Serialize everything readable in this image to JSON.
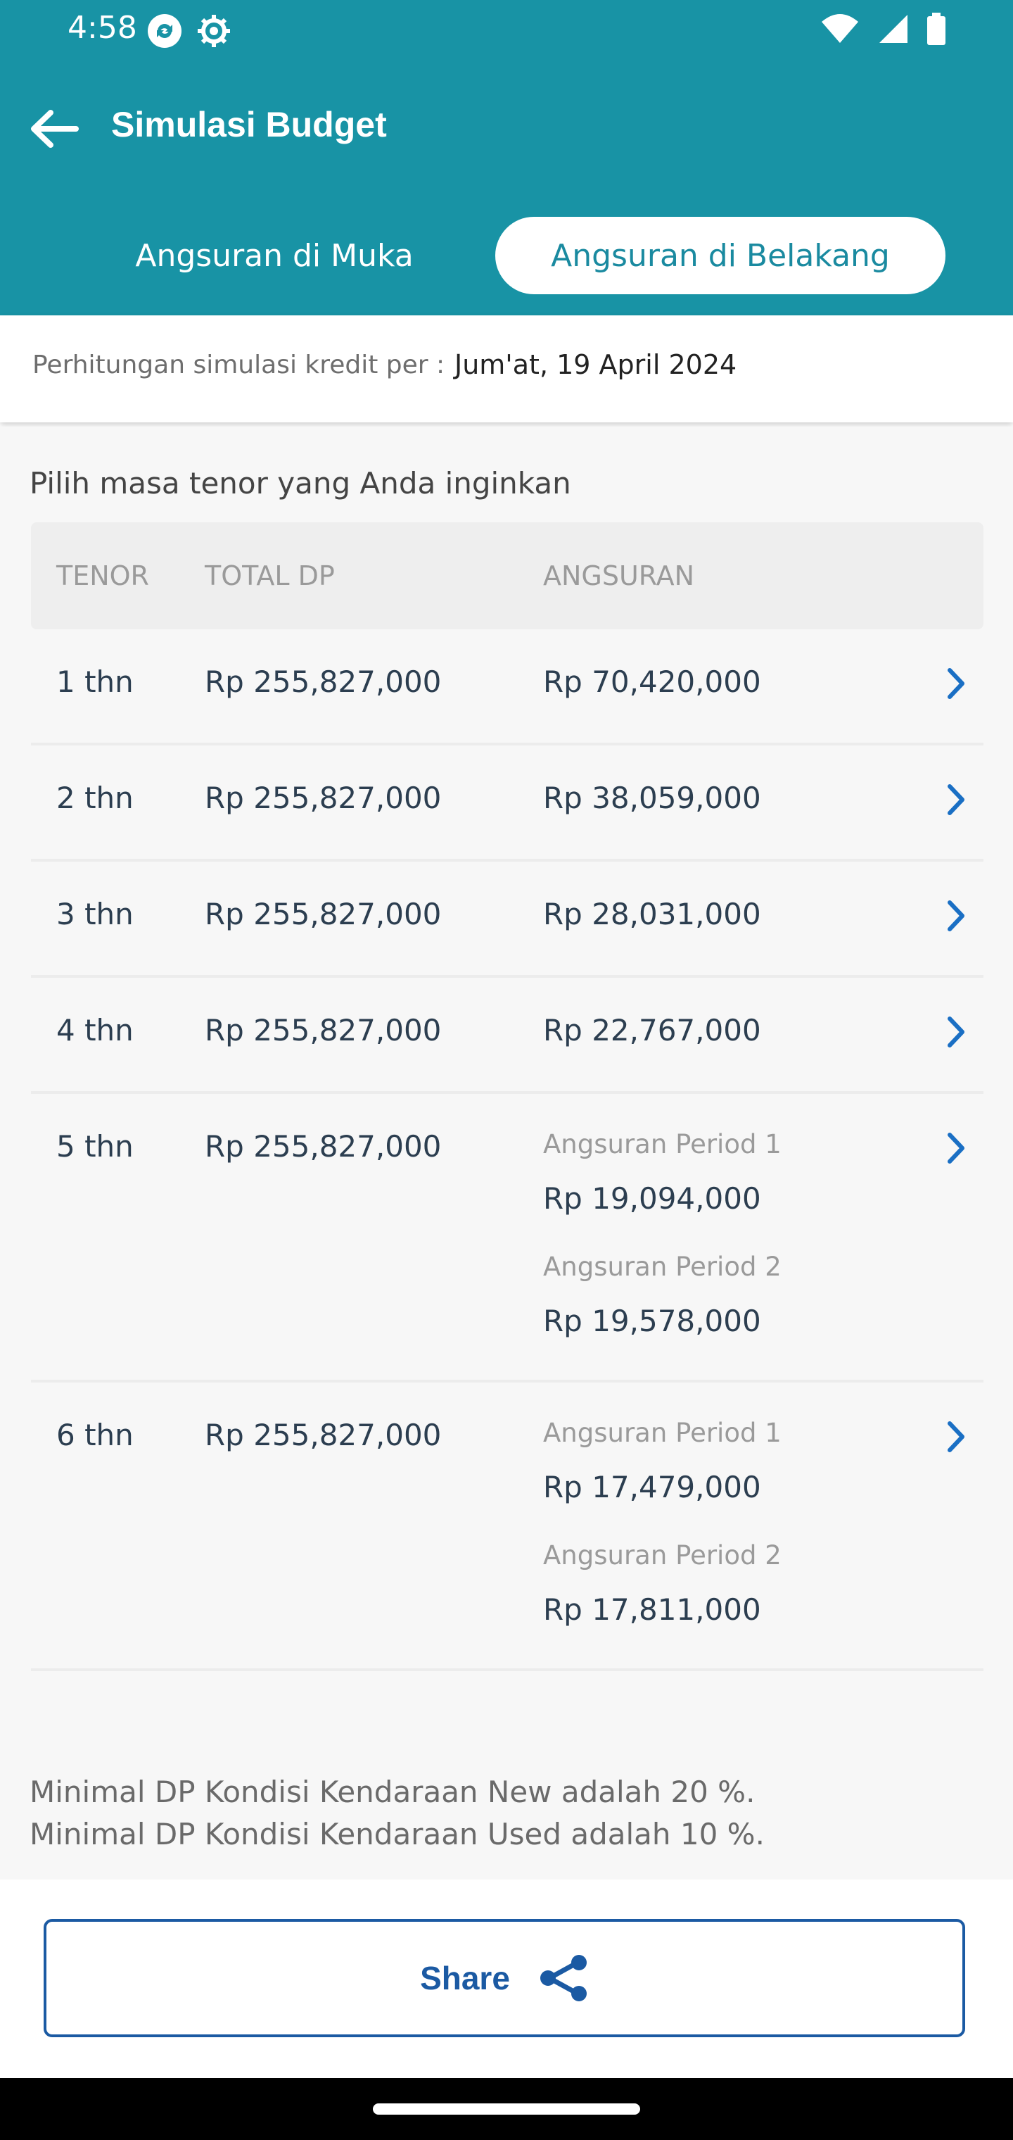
{
  "status_bar": {
    "time": "4:58"
  },
  "header": {
    "title": "Simulasi Budget"
  },
  "tabs": [
    {
      "label": "Angsuran di Muka",
      "selected": false
    },
    {
      "label": "Angsuran di Belakang",
      "selected": true
    }
  ],
  "simulation_date": {
    "label": "Perhitungan simulasi kredit per :",
    "value": "Jum'at, 19 April 2024"
  },
  "section_title": "Pilih masa tenor yang Anda inginkan",
  "table": {
    "headers": [
      "TENOR",
      "TOTAL DP",
      "ANGSURAN"
    ],
    "rows": [
      {
        "tenor": "1 thn",
        "dp": "Rp 255,827,000",
        "angsuran": "Rp 70,420,000"
      },
      {
        "tenor": "2 thn",
        "dp": "Rp 255,827,000",
        "angsuran": "Rp 38,059,000"
      },
      {
        "tenor": "3 thn",
        "dp": "Rp 255,827,000",
        "angsuran": "Rp 28,031,000"
      },
      {
        "tenor": "4 thn",
        "dp": "Rp 255,827,000",
        "angsuran": "Rp 22,767,000"
      },
      {
        "tenor": "5 thn",
        "dp": "Rp 255,827,000",
        "periods": [
          {
            "label": "Angsuran Period 1",
            "value": "Rp 19,094,000"
          },
          {
            "label": "Angsuran Period 2",
            "value": "Rp 19,578,000"
          }
        ]
      },
      {
        "tenor": "6 thn",
        "dp": "Rp 255,827,000",
        "periods": [
          {
            "label": "Angsuran Period 1",
            "value": "Rp 17,479,000"
          },
          {
            "label": "Angsuran Period 2",
            "value": "Rp 17,811,000"
          }
        ]
      }
    ]
  },
  "notes": [
    "Minimal DP Kondisi Kendaraan New adalah 20 %.",
    "Minimal DP Kondisi Kendaraan Used adalah 10 %."
  ],
  "footer": {
    "share_label": "Share"
  },
  "colors": {
    "header_bg": "#1893a5",
    "accent_blue": "#1b5aa3",
    "chevron": "#1a6fc4"
  }
}
